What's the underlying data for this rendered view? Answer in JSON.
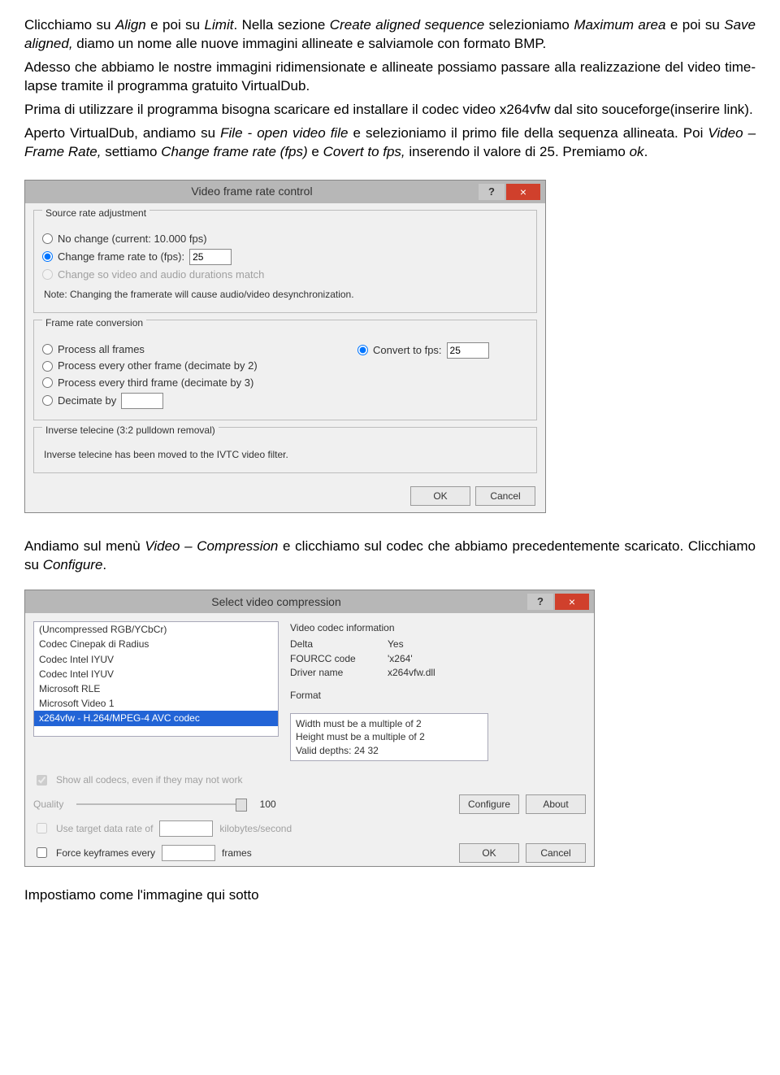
{
  "para1_a": "Clicchiamo su ",
  "para1_i1": "Align",
  "para1_b": " e poi su ",
  "para1_i2": "Limit",
  "para1_c": ". Nella sezione ",
  "para1_i3": "Create aligned sequence",
  "para1_d": " selezioniamo ",
  "para1_i4": "Maximum area",
  "para1_e": " e poi su ",
  "para1_i5": "Save aligned,",
  "para1_f": " diamo un nome alle nuove immagini allineate e salviamole con formato BMP.",
  "para2": "Adesso che abbiamo le nostre immagini ridimensionate e allineate possiamo passare alla realizzazione del video time-lapse tramite il programma gratuito VirtualDub.",
  "para3": "Prima di utilizzare il programma bisogna scaricare ed installare il codec video x264vfw dal sito souceforge(inserire link).",
  "para4_a": "Aperto VirtualDub, andiamo su ",
  "para4_i1": "File - open video file",
  "para4_b": " e selezioniamo il primo file della sequenza allineata. Poi ",
  "para4_i2": "Video – Frame Rate,",
  "para4_c": " settiamo ",
  "para4_i3": "Change frame rate (fps)",
  "para4_d": " e ",
  "para4_i4": "Covert to fps,",
  "para4_e": " inserendo il valore di 25. Premiamo ",
  "para4_i5": "ok",
  "para4_f": ".",
  "dlg1": {
    "title": "Video frame rate control",
    "help": "?",
    "close": "×",
    "g1": {
      "legend": "Source rate adjustment",
      "opt1": "No change (current: 10.000 fps)",
      "opt2": "Change frame rate to (fps):",
      "val2": "25",
      "opt3": "Change so video and audio durations match",
      "note": "Note: Changing the framerate will cause audio/video desynchronization."
    },
    "g2": {
      "legend": "Frame rate conversion",
      "opt1": "Process all frames",
      "opt2": "Process every other frame (decimate by 2)",
      "opt3": "Process every third frame (decimate by 3)",
      "opt4": "Decimate by",
      "optR": "Convert to fps:",
      "valR": "25"
    },
    "g3": {
      "legend": "Inverse telecine (3:2 pulldown removal)",
      "text": "Inverse telecine has been moved to the IVTC video filter."
    },
    "ok": "OK",
    "cancel": "Cancel"
  },
  "mid_a": "Andiamo sul menù ",
  "mid_i1": "Video – Compression",
  "mid_b": " e clicchiamo sul codec che abbiamo precedentemente scaricato. Clicchiamo su ",
  "mid_i2": "Configure",
  "mid_c": ".",
  "dlg2": {
    "title": "Select video compression",
    "help": "?",
    "close": "×",
    "codecs": [
      "(Uncompressed RGB/YCbCr)",
      "Codec Cinepak di Radius",
      "Codec Intel IYUV",
      "Codec Intel IYUV",
      "Microsoft RLE",
      "Microsoft Video 1",
      "x264vfw - H.264/MPEG-4 AVC codec"
    ],
    "info_label": "Video codec information",
    "kv": [
      {
        "k": "Delta",
        "v": "Yes"
      },
      {
        "k": "FOURCC code",
        "v": "'x264'"
      },
      {
        "k": "Driver name",
        "v": "x264vfw.dll"
      }
    ],
    "fmt_label": "Format",
    "fmt_lines": [
      "Width must be a multiple of 2",
      "Height must be a multiple of 2",
      "Valid depths: 24 32"
    ],
    "show_all": "Show all codecs, even if they may not work",
    "quality": "Quality",
    "quality_val": "100",
    "configure": "Configure",
    "about": "About",
    "use_rate": "Use target data rate of",
    "rate_unit": "kilobytes/second",
    "force_kf": "Force keyframes every",
    "kf_unit": "frames",
    "ok": "OK",
    "cancel": "Cancel"
  },
  "last": "Impostiamo come l'immagine qui sotto"
}
